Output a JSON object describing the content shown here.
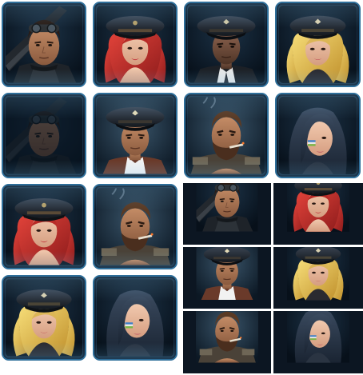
{
  "grid": {
    "title": "",
    "colors": {
      "frame": "#2f6f9a",
      "background": "#0e1a27",
      "page": "#ffffff"
    }
  },
  "portraits": [
    {
      "character": "sniper-goggles-man",
      "variant": "framed"
    },
    {
      "character": "red-hair-officer-woman",
      "variant": "framed"
    },
    {
      "character": "officer-cap-man",
      "variant": "framed"
    },
    {
      "character": "blonde-officer-woman",
      "variant": "framed"
    },
    {
      "character": "sniper-goggles-man-dark",
      "variant": "framed"
    },
    {
      "character": "officer-cap-man-light",
      "variant": "framed"
    },
    {
      "character": "bearded-smoker-man",
      "variant": "framed"
    },
    {
      "character": "blue-hair-warpaint-woman",
      "variant": "framed"
    },
    {
      "character": "red-hair-officer-woman",
      "variant": "framed"
    },
    {
      "character": "bearded-smoker-man",
      "variant": "framed"
    },
    {
      "character": "sniper-goggles-man",
      "variant": "flat"
    },
    {
      "character": "red-hair-officer-woman",
      "variant": "flat"
    },
    {
      "character": "blonde-officer-woman",
      "variant": "framed"
    },
    {
      "character": "blue-hair-warpaint-woman",
      "variant": "framed"
    },
    {
      "character": "officer-cap-man",
      "variant": "flat"
    },
    {
      "character": "blonde-officer-woman",
      "variant": "flat"
    },
    {
      "character": "bearded-smoker-man",
      "variant": "flat"
    },
    {
      "character": "blue-hair-warpaint-woman",
      "variant": "flat"
    }
  ]
}
